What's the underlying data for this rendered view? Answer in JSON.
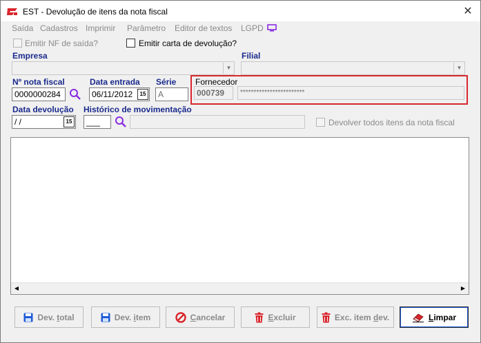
{
  "window": {
    "title": "EST - Devolução de itens da nota fiscal",
    "close_glyph": "✕"
  },
  "menu": {
    "items": [
      "Saída",
      "Cadastros",
      "Imprimir",
      "Parâmetro",
      "Editor de textos",
      "LGPD"
    ],
    "lgpd_icon": "monitor-icon",
    "lgpd_icon_color": "#8a2be2"
  },
  "options": {
    "emitir_nf_label": "Emitir NF de saída?",
    "emitir_nf_checked": false,
    "emitir_carta_label": "Emitir carta de devolução?",
    "emitir_carta_checked": false
  },
  "form": {
    "empresa_label": "Empresa",
    "empresa_value": "",
    "filial_label": "Filial",
    "filial_value": "",
    "nota_label": "Nº nota fiscal",
    "nota_value": "0000000284",
    "data_entrada_label": "Data entrada",
    "data_entrada_value": "06/11/2012",
    "serie_label": "Série",
    "serie_value": "A",
    "fornecedor_label": "Fornecedor",
    "fornecedor_code": "000739",
    "fornecedor_name": "************************",
    "data_devolucao_label": "Data devolução",
    "data_devolucao_value": " /  /",
    "historico_label": "Histórico de movimentação",
    "historico_code": "___",
    "historico_desc": "",
    "devolver_todos_label": "Devolver todos itens da nota fiscal",
    "devolver_todos_checked": false,
    "calendar_glyph": "15"
  },
  "buttons": {
    "dev_total": {
      "pre": "Dev. ",
      "u": "t",
      "post": "otal",
      "icon": "floppy-icon"
    },
    "dev_item": {
      "pre": "Dev. ",
      "u": "i",
      "post": "tem",
      "icon": "floppy-icon"
    },
    "cancelar": {
      "pre": "",
      "u": "C",
      "post": "ancelar",
      "icon": "cancel-icon"
    },
    "excluir": {
      "pre": "",
      "u": "E",
      "post": "xcluir",
      "icon": "trash-icon"
    },
    "exc_item_dev": {
      "pre": "Exc. item ",
      "u": "d",
      "post": "ev.",
      "icon": "trash-icon"
    },
    "limpar": {
      "pre": "",
      "u": "L",
      "post": "impar",
      "icon": "eraser-icon"
    }
  },
  "colors": {
    "label_blue": "#1a2a8c",
    "highlight_red": "#d9262c",
    "search_purple": "#8a2be2",
    "button_blue": "#1e5bd6"
  }
}
